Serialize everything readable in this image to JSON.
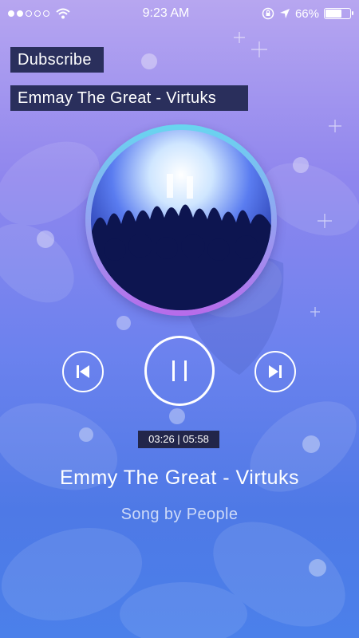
{
  "status_bar": {
    "time": "9:23 AM",
    "battery": "66%",
    "battery_level": 0.66,
    "icons": [
      "signal-dots-icon",
      "wifi-icon",
      "rotation-lock-icon",
      "location-arrow-icon",
      "battery-icon"
    ]
  },
  "subscribe_label": "Dubscribe",
  "track_label": "Emmay The Great - Virtuks",
  "player": {
    "time": "03:26 | 05:58",
    "title": "Emmy The Great - Virtuks",
    "subtitle": "Song by People",
    "controls": [
      "previous-icon",
      "pause-icon",
      "next-icon"
    ]
  },
  "colors": {
    "label_bg": "#2a2f5c",
    "ring_top": "#67d6ef",
    "ring_bottom": "#b86bea"
  }
}
